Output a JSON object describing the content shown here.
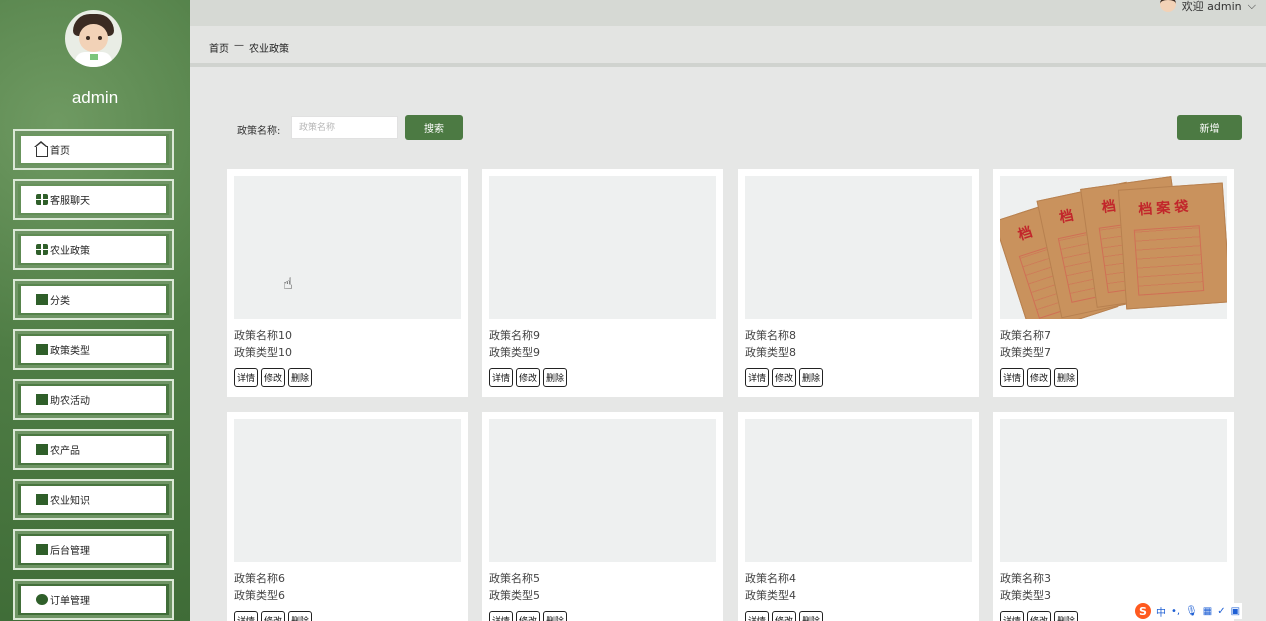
{
  "user": {
    "name": "admin",
    "welcome": "欢迎 admin"
  },
  "sidebar": {
    "items": [
      {
        "label": "首页",
        "icon": "home-icon"
      },
      {
        "label": "客服聊天",
        "icon": "chat-icon"
      },
      {
        "label": "农业政策",
        "icon": "grid-icon"
      },
      {
        "label": "分类",
        "icon": "category-icon"
      },
      {
        "label": "政策类型",
        "icon": "policy-type-icon"
      },
      {
        "label": "助农活动",
        "icon": "activity-icon"
      },
      {
        "label": "农产品",
        "icon": "product-icon"
      },
      {
        "label": "农业知识",
        "icon": "knowledge-icon"
      },
      {
        "label": "后台管理",
        "icon": "admin-icon"
      },
      {
        "label": "订单管理",
        "icon": "order-icon"
      }
    ]
  },
  "breadcrumb": {
    "home": "首页",
    "separator": "—",
    "current": "农业政策"
  },
  "search": {
    "label": "政策名称:",
    "placeholder": "政策名称",
    "button": "搜索"
  },
  "toolbar": {
    "add": "新增"
  },
  "cards": [
    {
      "name": "政策名称10",
      "type": "政策类型10"
    },
    {
      "name": "政策名称9",
      "type": "政策类型9"
    },
    {
      "name": "政策名称8",
      "type": "政策类型8"
    },
    {
      "name": "政策名称7",
      "type": "政策类型7"
    },
    {
      "name": "政策名称6",
      "type": "政策类型6"
    },
    {
      "name": "政策名称5",
      "type": "政策类型5"
    },
    {
      "name": "政策名称4",
      "type": "政策类型4"
    },
    {
      "name": "政策名称3",
      "type": "政策类型3"
    }
  ],
  "card_actions": {
    "detail": "详情",
    "edit": "修改",
    "delete": "删除"
  },
  "image_text": {
    "envelope": "档案袋"
  },
  "tray": {
    "ime": "中"
  },
  "colors": {
    "sidebar": "#4f7d45",
    "accent": "#4c7a43",
    "background": "#e6e7e6"
  }
}
